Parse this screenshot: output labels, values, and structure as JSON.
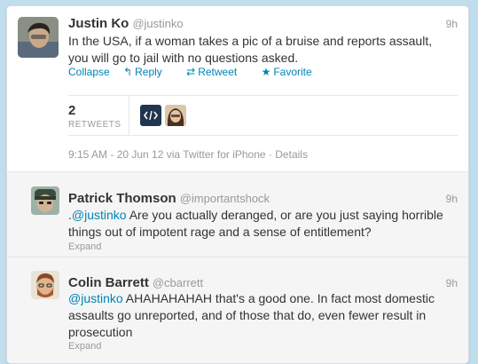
{
  "main_tweet": {
    "fullname": "Justin Ko",
    "username": "@justinko",
    "time": "9h",
    "text_line1": "In the USA, if a woman takes a pic of a bruise and reports assault,",
    "text_line2": "you will go to jail with no questions asked.",
    "actions": {
      "collapse": "Collapse",
      "reply": "Reply",
      "retweet": "Retweet",
      "favorite": "Favorite"
    },
    "retweet_count": "2",
    "retweet_label": "RETWEETS",
    "timestamp": "9:15 AM - 20 Jun 12 via Twitter for iPhone",
    "separator": "·",
    "details": "Details"
  },
  "replies": [
    {
      "fullname": "Patrick Thomson",
      "username": "@importantshock",
      "time": "9h",
      "prefix": ".",
      "mention": "@justinko",
      "text_line1": " Are you actually deranged, or are you just saying horrible",
      "text_line2": "things out of impotent rage and a sense of entitlement?",
      "expand": "Expand"
    },
    {
      "fullname": "Colin Barrett",
      "username": "@cbarrett",
      "time": "9h",
      "mention": "@justinko",
      "text_line1": " AHAHAHAHAH that's a good one. In fact most domestic",
      "text_line2": "assaults go unreported, and of those that do, even fewer result in",
      "text_line3": "prosecution",
      "expand": "Expand"
    }
  ],
  "colors": {
    "background": "#c0deed",
    "link": "#0084b4",
    "muted": "#999999",
    "text": "#333333"
  },
  "icons": {
    "reply": "reply-arrow-icon",
    "retweet": "retweet-arrows-icon",
    "favorite": "star-icon"
  }
}
